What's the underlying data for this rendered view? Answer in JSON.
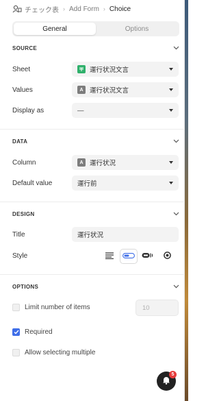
{
  "breadcrumb": {
    "app": "チェック表",
    "form": "Add Form",
    "current": "Choice"
  },
  "tabs": [
    {
      "label": "General",
      "active": true
    },
    {
      "label": "Options",
      "active": false
    }
  ],
  "source": {
    "title": "SOURCE",
    "sheet_label": "Sheet",
    "sheet_value": "運行状況文言",
    "sheet_icon": "sheet-icon",
    "values_label": "Values",
    "values_value": "運行状況文言",
    "values_icon": "A",
    "display_label": "Display as",
    "display_value": "—"
  },
  "data": {
    "title": "DATA",
    "column_label": "Column",
    "column_value": "運行状況",
    "column_icon": "A",
    "default_label": "Default value",
    "default_value": "運行前"
  },
  "design": {
    "title": "DESIGN",
    "title_label": "Title",
    "title_value": "運行状況",
    "style_label": "Style",
    "styles": [
      "list-icon",
      "toggle-pill-icon",
      "toggle-switch-icon",
      "radio-icon"
    ],
    "active_style": 1
  },
  "options": {
    "title": "OPTIONS",
    "limit_label": "Limit number of items",
    "limit_checked": false,
    "limit_value": "10",
    "required_label": "Required",
    "required_checked": true,
    "multiple_label": "Allow selecting multiple",
    "multiple_checked": false
  },
  "notifications": {
    "count": "5"
  },
  "colors": {
    "accent": "#3f6ee8",
    "sheet_green": "#2fb06b",
    "badge_red": "#e53b3b"
  }
}
